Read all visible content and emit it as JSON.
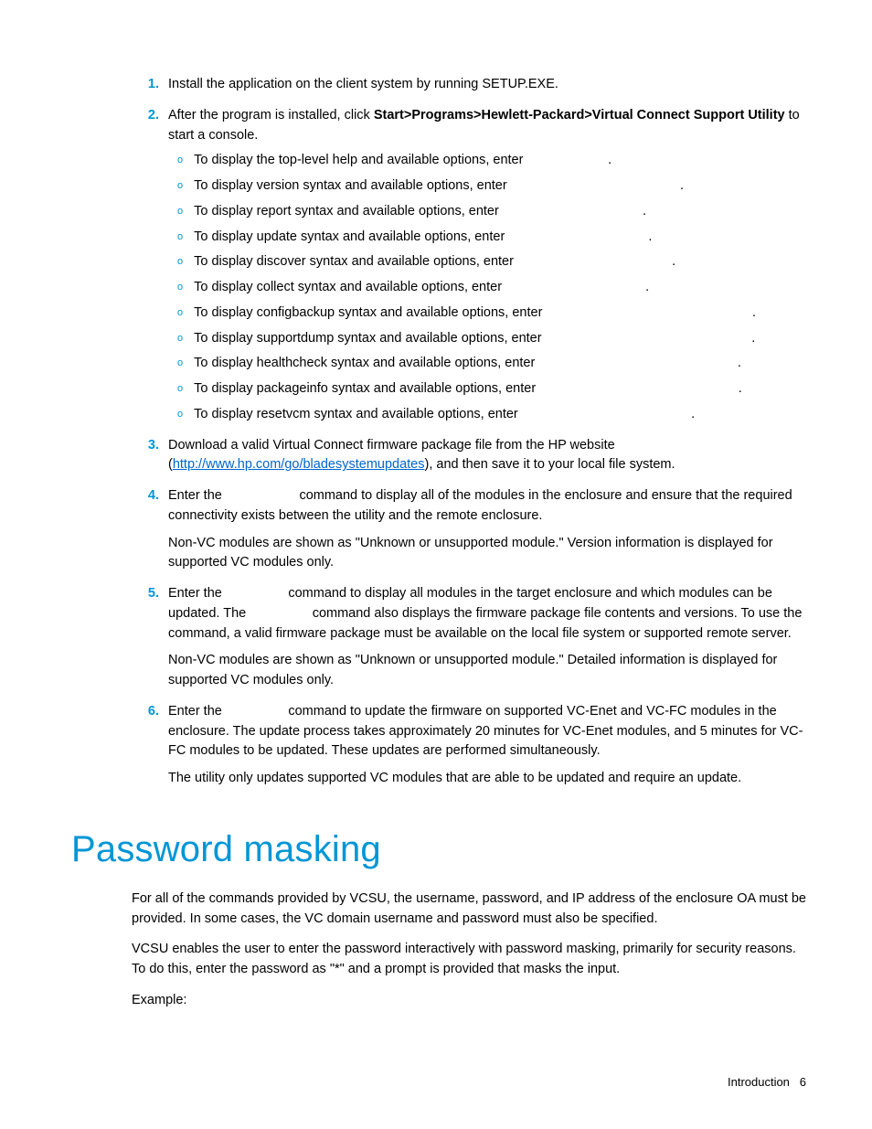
{
  "steps": [
    {
      "num": "1.",
      "paras": [
        "Install the application on the client system by running SETUP.EXE."
      ]
    },
    {
      "num": "2.",
      "intro_prefix": "After the program is installed, click ",
      "intro_bold": "Start>Programs>Hewlett-Packard>Virtual Connect Support Utility",
      "intro_suffix": " to start a console.",
      "subs": [
        "To display the top-level help and available options, enter",
        "To display version syntax and available options, enter",
        "To display report syntax and available options, enter",
        "To display update syntax and available options, enter",
        "To display discover syntax and available options, enter",
        "To display collect syntax and available options, enter",
        "To display configbackup syntax and available options, enter",
        "To display supportdump syntax and available options, enter",
        "To display healthcheck syntax and available options, enter",
        "To display packageinfo syntax and available options, enter",
        "To display resetvcm syntax and available options, enter"
      ],
      "sub_trailing": [
        "                       .",
        "                                               .",
        "                                       .",
        "                                       .",
        "                                           .",
        "                                       .",
        "                                                         .",
        "                                                         .",
        "                                                       .",
        "                                                       .",
        "                                               ."
      ]
    },
    {
      "num": "3.",
      "paras_html": [
        {
          "prefix": "Download a valid Virtual Connect firmware package file from the HP website (",
          "link_text": "http://www.hp.com/go/bladesystemupdates",
          "link_href": "http://www.hp.com/go/bladesystemupdates",
          "suffix": "), and then save it to your local file system."
        }
      ]
    },
    {
      "num": "4.",
      "paras": [
        "Enter the                     command to display all of the modules in the enclosure and ensure that the required connectivity exists between the utility and the remote enclosure.",
        "Non-VC modules are shown as \"Unknown or unsupported module.\" Version information is displayed for supported VC modules only."
      ]
    },
    {
      "num": "5.",
      "paras": [
        "Enter the                  command to display all modules in the target enclosure and which modules can be updated. The                  command also displays the firmware package file contents and versions. To use the                  command, a valid firmware package must be available on the local file system or supported remote server.",
        "Non-VC modules are shown as \"Unknown or unsupported module.\" Detailed information is displayed for supported VC modules only."
      ]
    },
    {
      "num": "6.",
      "paras": [
        "Enter the                  command to update the firmware on supported VC-Enet and VC-FC modules in the enclosure. The update process takes approximately 20 minutes for VC-Enet modules, and 5 minutes for VC-FC modules to be updated. These updates are performed simultaneously.",
        "The utility only updates supported VC modules that are able to be updated and require an update."
      ]
    }
  ],
  "section_heading": "Password masking",
  "section_paras": [
    "For all of the commands provided by VCSU, the username, password, and IP address of the enclosure OA must be provided. In some cases, the VC domain username and password must also be specified.",
    "VCSU enables the user to enter the password interactively with password masking, primarily for security reasons. To do this, enter the password as \"*\" and a prompt is provided that masks the input.",
    "Example:"
  ],
  "footer_section": "Introduction",
  "footer_page": "6"
}
